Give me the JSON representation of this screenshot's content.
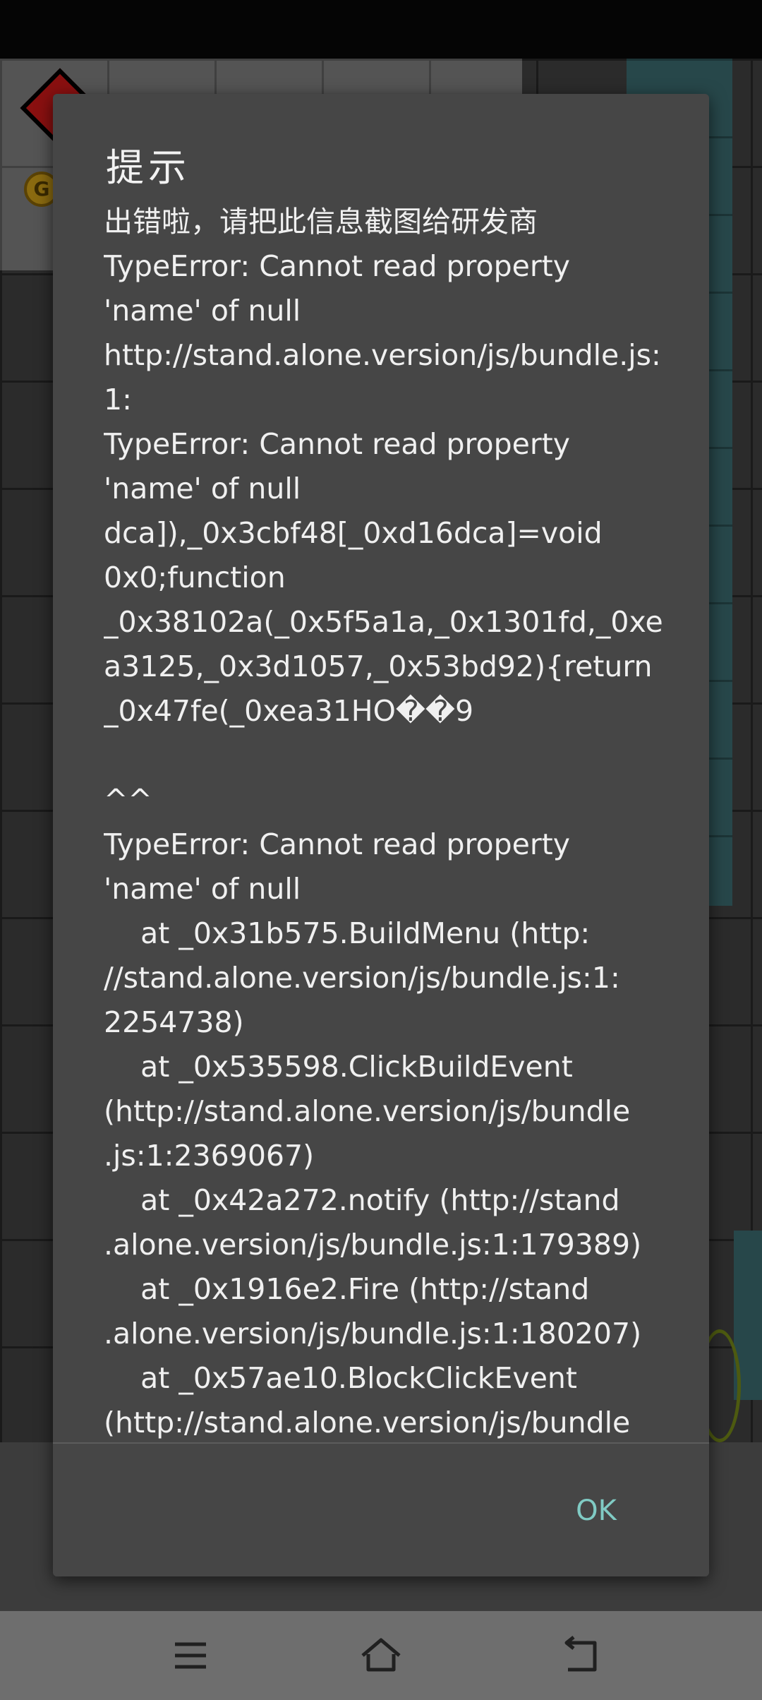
{
  "dialog": {
    "title": "提示",
    "lines": [
      "出错啦，请把此信息截图给研发商",
      "TypeError: Cannot read property",
      "'name' of null",
      "http://stand.alone.version/js/bundle.js:",
      "1:",
      "TypeError: Cannot read property",
      "'name' of null",
      "dca]),_0x3cbf48[_0xd16dca]=void",
      "0x0;function",
      "_0x38102a(_0x5f5a1a,_0x1301fd,_0xe",
      "a3125,_0x3d1057,_0x53bd92){return",
      "_0x47fe(_0xea31HO��9",
      "",
      "^^",
      "TypeError: Cannot read property",
      "'name' of null",
      "    at _0x31b575.BuildMenu (http:",
      "//stand.alone.version/js/bundle.js:1:",
      "2254738)",
      "    at _0x535598.ClickBuildEvent",
      "(http://stand.alone.version/js/bundle",
      ".js:1:2369067)",
      "    at _0x42a272.notify (http://stand",
      ".alone.version/js/bundle.js:1:179389)",
      "    at _0x1916e2.Fire (http://stand",
      ".alone.version/js/bundle.js:1:180207)",
      "    at _0x57ae10.BlockClickEvent",
      "(http://stand.alone.version/js/bundle"
    ],
    "ok_label": "OK"
  },
  "background": {
    "coin_label": "G"
  },
  "nav": {
    "menu_icon": "menu-icon",
    "home_icon": "home-icon",
    "back_icon": "back-icon"
  },
  "colors": {
    "dialog_bg": "#464646",
    "accent": "#80cbc4",
    "nav_bg": "#6e6e6e"
  }
}
